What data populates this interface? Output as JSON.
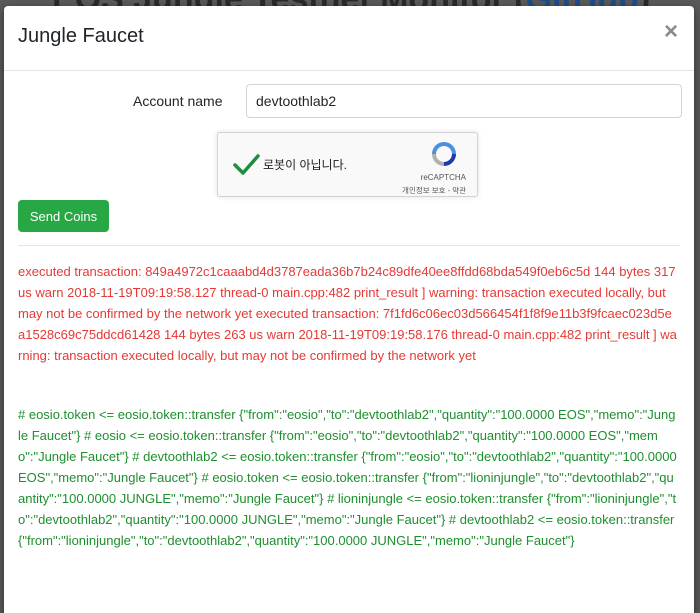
{
  "backdrop": {
    "title": "EOS Jungle Testnet Monitor (",
    "link": "GitHub",
    "suffix": ")"
  },
  "modal": {
    "title": "Jungle Faucet",
    "close_label": "×",
    "account_label": "Account name",
    "account_value": "devtoothlab2",
    "recaptcha": {
      "label": "로봇이 아닙니다.",
      "brand": "reCAPTCHA",
      "terms": "개인정보 보호 - 약관",
      "checked": true
    },
    "send_button": "Send Coins",
    "error_output": "executed transaction: 849a4972c1caaabd4d3787eada36b7b24c89dfe40ee8ffdd68bda549f0eb6c5d 144 bytes 317 us warn 2018-11-19T09:19:58.127 thread-0 main.cpp:482 print_result ] warning: transaction executed locally, but may not be confirmed by the network yet executed transaction: 7f1fd6c06ec03d566454f1f8f9e11b3f9fcaec023d5ea1528c69c75ddcd61428 144 bytes 263 us warn 2018-11-19T09:19:58.176 thread-0 main.cpp:482 print_result ] warning: transaction executed locally, but may not be confirmed by the network yet",
    "success_output": "# eosio.token <= eosio.token::transfer {\"from\":\"eosio\",\"to\":\"devtoothlab2\",\"quantity\":\"100.0000 EOS\",\"memo\":\"Jungle Faucet\"} # eosio <= eosio.token::transfer {\"from\":\"eosio\",\"to\":\"devtoothlab2\",\"quantity\":\"100.0000 EOS\",\"memo\":\"Jungle Faucet\"} # devtoothlab2 <= eosio.token::transfer {\"from\":\"eosio\",\"to\":\"devtoothlab2\",\"quantity\":\"100.0000 EOS\",\"memo\":\"Jungle Faucet\"} # eosio.token <= eosio.token::transfer {\"from\":\"lioninjungle\",\"to\":\"devtoothlab2\",\"quantity\":\"100.0000 JUNGLE\",\"memo\":\"Jungle Faucet\"} # lioninjungle <= eosio.token::transfer {\"from\":\"lioninjungle\",\"to\":\"devtoothlab2\",\"quantity\":\"100.0000 JUNGLE\",\"memo\":\"Jungle Faucet\"} # devtoothlab2 <= eosio.token::transfer {\"from\":\"lioninjungle\",\"to\":\"devtoothlab2\",\"quantity\":\"100.0000 JUNGLE\",\"memo\":\"Jungle Faucet\"}"
  },
  "colors": {
    "error": "#e53935",
    "success": "#1e8f2e",
    "send_button": "#28a745",
    "checkmark": "#1e8e3e"
  },
  "icons": [
    "close-icon",
    "checkmark-icon",
    "recaptcha-logo-icon"
  ]
}
